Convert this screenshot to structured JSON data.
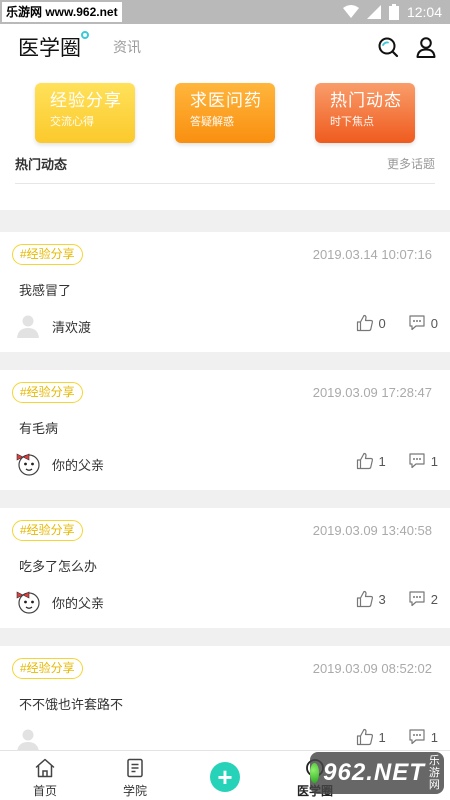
{
  "status_bar": {
    "watermark": "乐游网 www.962.net",
    "time": "12:04"
  },
  "header": {
    "title": "医学圈",
    "tab_news": "资讯",
    "icons": [
      "search-icon",
      "user-icon"
    ]
  },
  "cards": [
    {
      "title": "经验分享",
      "subtitle": "交流心得"
    },
    {
      "title": "求医问药",
      "subtitle": "答疑解惑"
    },
    {
      "title": "热门动态",
      "subtitle": "时下焦点"
    }
  ],
  "section": {
    "title": "热门动态",
    "more": "更多话题"
  },
  "posts": [
    {
      "tag": "#经验分享",
      "time": "2019.03.14 10:07:16",
      "content": "我感冒了",
      "author": "清欢渡",
      "avatar": "default",
      "likes": "0",
      "comments": "0"
    },
    {
      "tag": "#经验分享",
      "time": "2019.03.09 17:28:47",
      "content": "有毛病",
      "author": "你的父亲",
      "avatar": "cartoon",
      "likes": "1",
      "comments": "1"
    },
    {
      "tag": "#经验分享",
      "time": "2019.03.09 13:40:58",
      "content": "吃多了怎么办",
      "author": "你的父亲",
      "avatar": "cartoon",
      "likes": "3",
      "comments": "2"
    },
    {
      "tag": "#经验分享",
      "time": "2019.03.09 08:52:02",
      "content": "不不饿也许套路不",
      "author": "",
      "avatar": "default",
      "likes": "1",
      "comments": "1"
    }
  ],
  "bottom_nav": {
    "home": "首页",
    "academy": "学院",
    "circle": "医学圈"
  },
  "watermark_logo": {
    "number": "962.NET",
    "text": "乐游网"
  },
  "colors": {
    "accent": "#27d3b8",
    "tag_border": "#f5d532",
    "card1": "#fbc92c",
    "card2": "#f98f10",
    "card3": "#ef5b1e"
  }
}
